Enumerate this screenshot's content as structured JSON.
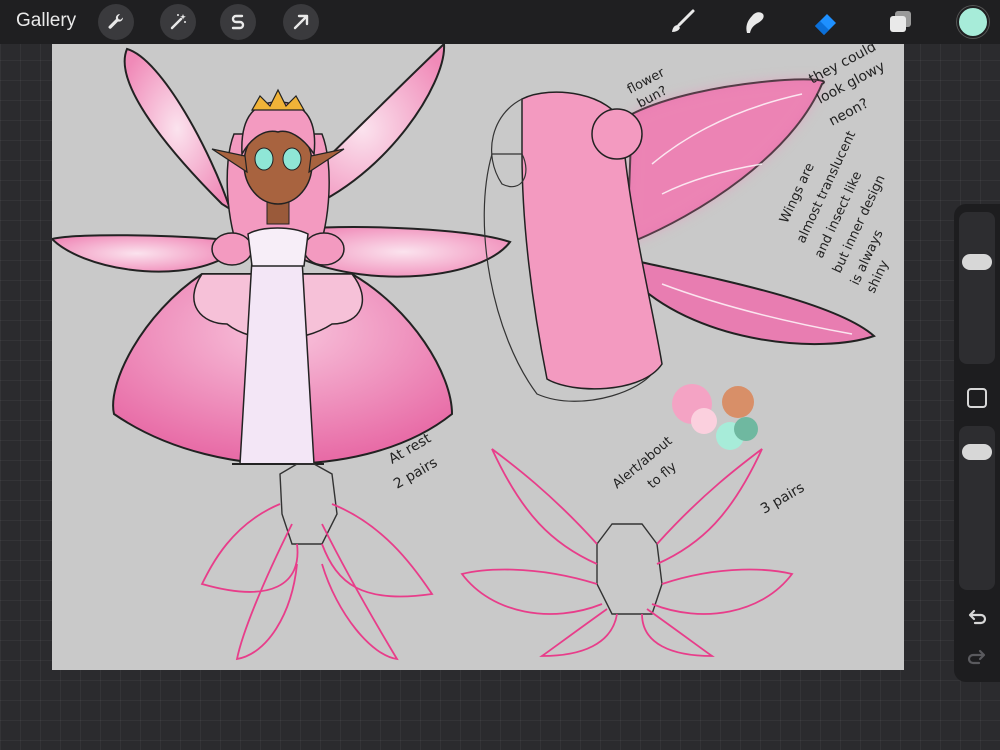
{
  "toolbar": {
    "gallery_label": "Gallery",
    "left_tools": [
      "wrench-icon",
      "magic-wand-icon",
      "selection-s-icon",
      "transform-arrow-icon"
    ],
    "right_tools": [
      "brush-icon",
      "smudge-icon",
      "eraser-icon",
      "layers-icon"
    ],
    "active_tool": "eraser-icon",
    "active_tool_color": "#1e90ff",
    "current_color": "#a7ecd9"
  },
  "canvas": {
    "background": "#c9c9c9",
    "annotations": {
      "flower_bun": [
        "flower",
        "bun?"
      ],
      "glow": [
        "they could",
        "look glowy",
        "neon?"
      ],
      "wings_note": [
        "Wings are",
        "almost translucent",
        "and insect like",
        "but inner design",
        "is always",
        "shiny"
      ],
      "at_rest": [
        "At rest",
        "2 pairs"
      ],
      "alert": [
        "Alert/about",
        "to fly"
      ],
      "three_pairs": "3 pairs"
    },
    "palette_colors": [
      "#f4a3c4",
      "#fbd0de",
      "#d88f68",
      "#a7ecd9",
      "#6fb8a0"
    ]
  },
  "sidebar": {
    "brush_size_level": 0.3,
    "opacity_level": 0.9
  }
}
